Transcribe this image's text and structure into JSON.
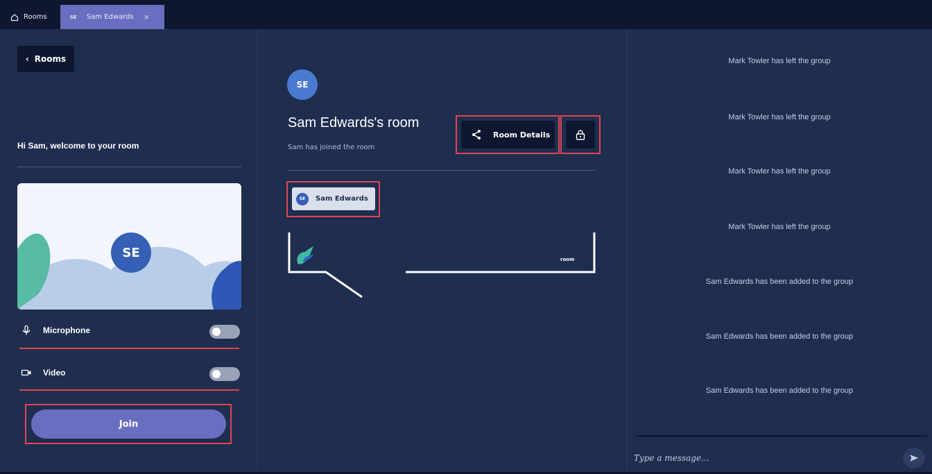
{
  "tabs": [
    {
      "label": "Rooms",
      "icon": "home-icon"
    },
    {
      "badge": "SE",
      "label": "Sam Edwards",
      "close": "×"
    }
  ],
  "left": {
    "back_label": "Rooms",
    "welcome": "Hi Sam, welcome to your room",
    "preview_initials": "SE",
    "microphone_label": "Microphone",
    "microphone_on": false,
    "video_label": "Video",
    "video_on": false,
    "join_label": "Join"
  },
  "room": {
    "initials": "SE",
    "title": "Sam Edwards's room",
    "subtitle": "Sam has joined the room",
    "details_label": "Room Details",
    "participant_initials": "SE",
    "participant_name": "Sam Edwards",
    "brand_text": "room"
  },
  "messages": [
    "Mark Towler has left the group",
    "Mark Towler has left the group",
    "Mark Towler has left the group",
    "Mark Towler has left the group",
    "Sam Edwards has been added to the group",
    "Sam Edwards has been added to the group",
    "Sam Edwards has been added to the group"
  ],
  "composer": {
    "placeholder": "Type a message..."
  },
  "colors": {
    "background": "#1f2d4f",
    "dark": "#0f1730",
    "accent": "#6a6ec0",
    "highlight": "#e04552",
    "avatar": "#3560b5"
  }
}
